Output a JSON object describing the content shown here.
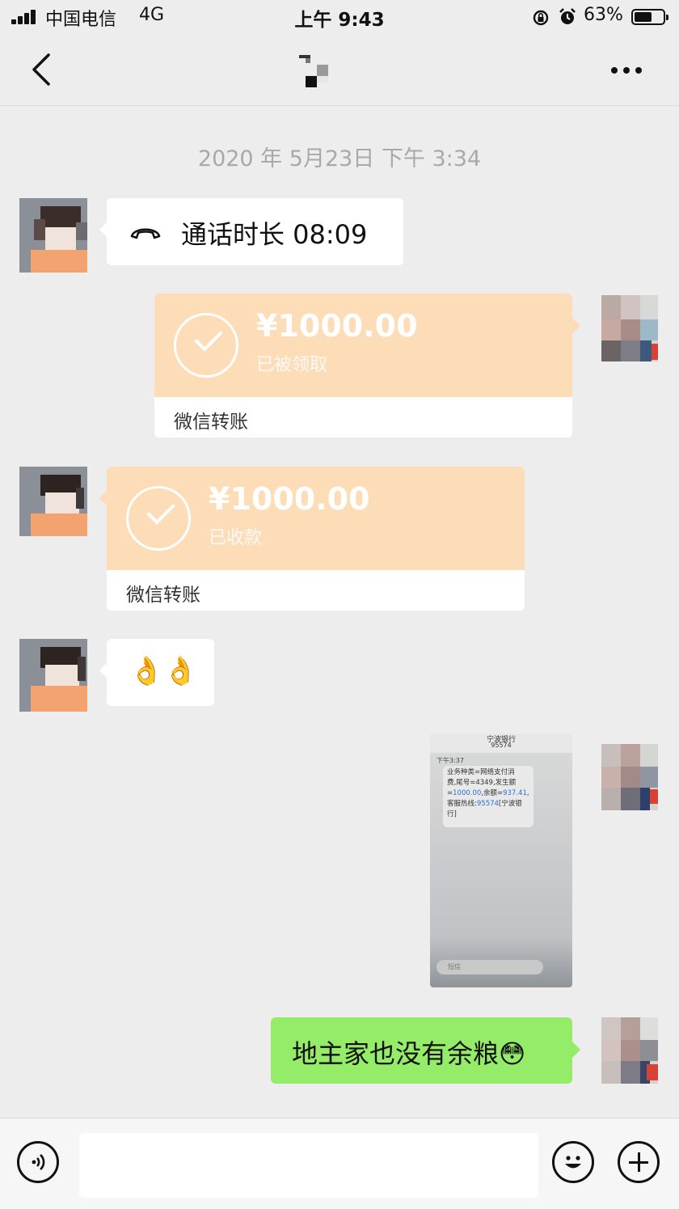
{
  "status_bar": {
    "carrier": "中国电信",
    "network": "4G",
    "time": "上午 9:43",
    "battery_percent": "63%",
    "battery_level": 0.63
  },
  "nav": {
    "back_icon": "chevron-left-icon",
    "more_icon": "more-dots-icon"
  },
  "chat": {
    "timestamp": "2020 年 5月23日 下午 3:34",
    "call": {
      "icon": "phone-hangup-icon",
      "text": "通话时长 08:09"
    },
    "transfer_sent": {
      "amount": "¥1000.00",
      "status": "已被领取",
      "label": "微信转账"
    },
    "transfer_received": {
      "amount": "¥1000.00",
      "status": "已收款",
      "label": "微信转账"
    },
    "emoji_message": "👌👌",
    "sms_image": {
      "sender": "宁波银行",
      "number": "95574",
      "time": "下午3:37",
      "line1": "业务种类=网络支付消",
      "line2": "费,尾号=4349,发生额",
      "line3_pre": "=",
      "amount": "1000.00",
      "line3_mid": ",余额=",
      "balance": "937.41",
      "line3_end": ",",
      "line4_pre": "客服热线:",
      "hotline": "95574",
      "line4_end": "[宁波银",
      "line5": "行]",
      "input_placeholder": "短信"
    },
    "text_message": "地主家也没有余粮",
    "text_message_emoji": "😳"
  },
  "input_bar": {
    "voice_icon": "voice-icon",
    "emoji_icon": "emoji-face-icon",
    "plus_icon": "plus-icon"
  },
  "colors": {
    "background": "#ededed",
    "transfer_orange": "#fddcb8",
    "sent_green": "#95ec69"
  }
}
